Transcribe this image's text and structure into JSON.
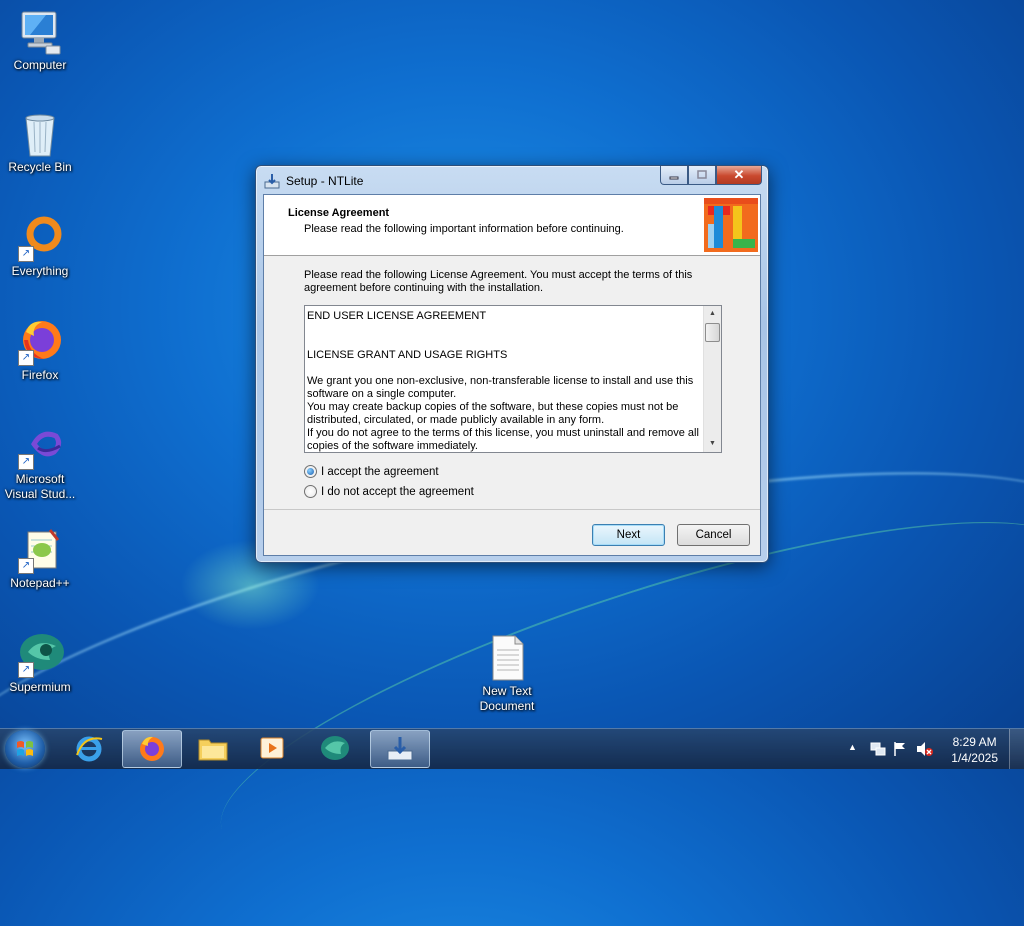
{
  "desktop": {
    "icons": [
      {
        "label": "Computer",
        "icon": "computer-icon"
      },
      {
        "label": "Recycle Bin",
        "icon": "recycle-bin-icon"
      },
      {
        "label": "Everything",
        "icon": "everything-icon"
      },
      {
        "label": "Firefox",
        "icon": "firefox-icon"
      },
      {
        "label": "Microsoft Visual Stud...",
        "icon": "visual-studio-icon"
      },
      {
        "label": "Notepad++",
        "icon": "notepadpp-icon"
      },
      {
        "label": "Supermium",
        "icon": "supermium-icon"
      },
      {
        "label": "New Text Document",
        "icon": "text-document-icon"
      }
    ]
  },
  "dialog": {
    "title": "Setup - NTLite",
    "header_title": "License Agreement",
    "header_subtitle": "Please read the following important information before continuing.",
    "intro": "Please read the following License Agreement. You must accept the terms of this agreement before continuing with the installation.",
    "license_lines": [
      "END USER LICENSE AGREEMENT",
      "",
      "",
      "LICENSE GRANT AND USAGE RIGHTS",
      "",
      "We grant you one non-exclusive, non-transferable license to install and use this software on a single computer.",
      "You may create backup copies of the software, but these copies must not be distributed, circulated, or made publicly available in any form.",
      "If you do not agree to the terms of this license, you must uninstall and remove all copies of the software immediately."
    ],
    "accept_label": "I accept the agreement",
    "decline_label": "I do not accept the agreement",
    "accept_selected": true,
    "next_label": "Next",
    "cancel_label": "Cancel"
  },
  "taskbar": {
    "items": [
      "start-orb-icon",
      "internet-explorer-icon",
      "firefox-icon",
      "file-explorer-icon",
      "media-player-icon",
      "supermium-icon",
      "setup-icon"
    ],
    "clock_time": "8:29 AM",
    "clock_date": "1/4/2025"
  },
  "colors": {
    "desktop_blue": "#0f6fd0",
    "dialog_frame": "#a8c4e6",
    "close_red": "#c9492e"
  }
}
